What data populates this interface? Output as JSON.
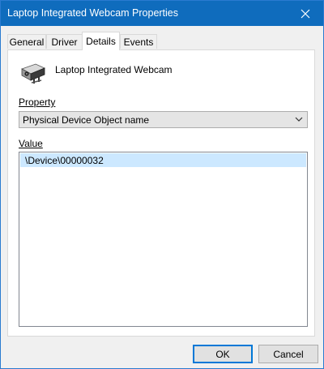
{
  "window": {
    "title": "Laptop Integrated Webcam Properties"
  },
  "tabs": [
    {
      "label": "General"
    },
    {
      "label": "Driver"
    },
    {
      "label": "Details"
    },
    {
      "label": "Events"
    }
  ],
  "details": {
    "device_name": "Laptop Integrated Webcam",
    "property_label": "Property",
    "property_selected": "Physical Device Object name",
    "value_label": "Value",
    "value_items": [
      "\\Device\\00000032"
    ]
  },
  "buttons": {
    "ok": "OK",
    "cancel": "Cancel"
  },
  "colors": {
    "titlebar": "#0f6cbd",
    "selection": "#cce8ff",
    "default_button_border": "#0078d7"
  }
}
